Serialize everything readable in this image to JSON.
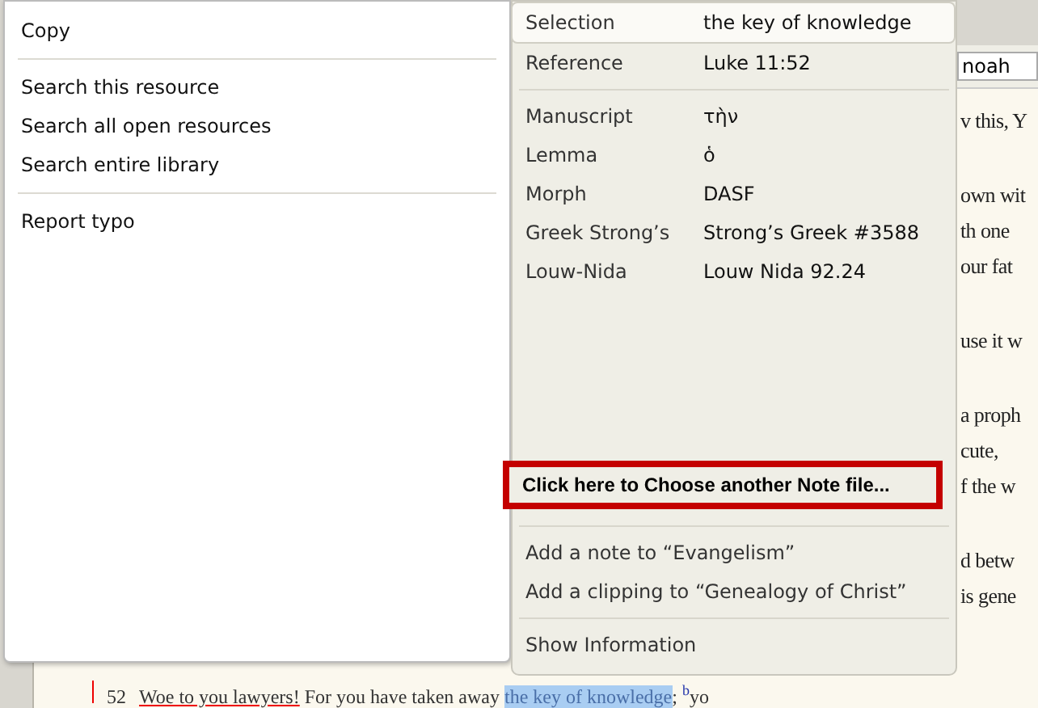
{
  "document": {
    "search": {
      "value": "noah"
    },
    "paragraphs": [
      [
        "v this, Y"
      ],
      [
        "own wit",
        "th one",
        "our fat"
      ],
      [
        "use it w"
      ],
      [
        "a proph",
        "cute,",
        "f the w"
      ],
      [
        "d betw",
        "is gene"
      ]
    ],
    "verse": {
      "number": "52",
      "underlined": "Woe to you lawyers!",
      "text": " For you have taken away ",
      "highlighted": "the key of knowledge",
      "after": "; ",
      "note": "b",
      "rest": "yo"
    }
  },
  "context_menu": {
    "groups": [
      [
        "Copy"
      ],
      [
        "Search this resource",
        "Search all open resources",
        "Search entire library"
      ],
      [
        "Report typo"
      ]
    ]
  },
  "info_panel": {
    "rows": [
      {
        "label": "Selection",
        "value": "the key of knowledge",
        "selected": true
      },
      {
        "label": "Reference",
        "value": "Luke 11:52",
        "selected": false
      }
    ],
    "details": [
      {
        "label": "Manuscript",
        "value": "τὴν"
      },
      {
        "label": "Lemma",
        "value": "ὁ"
      },
      {
        "label": "Morph",
        "value": "DASF"
      },
      {
        "label": "Greek Strong’s",
        "value": "Strong’s Greek #3588"
      },
      {
        "label": "Louw-Nida",
        "value": "Louw Nida 92.24"
      }
    ],
    "note_file_button": "Click here to Choose another Note file...",
    "actions": [
      "Add a note to “Evangelism”",
      "Add a clipping to “Genealogy of Christ”"
    ],
    "show_information": "Show Information"
  }
}
